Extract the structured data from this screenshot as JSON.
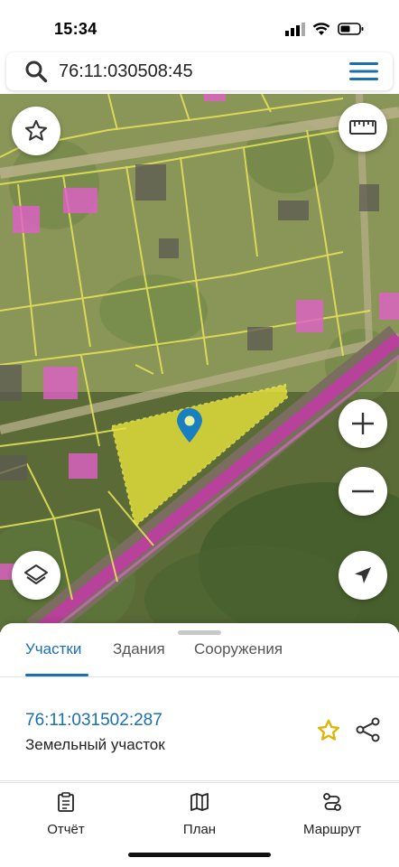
{
  "status_bar": {
    "time": "15:34",
    "battery_icon": "battery-icon",
    "wifi_icon": "wifi-icon",
    "signal_icon": "signal-icon"
  },
  "search": {
    "value": "76:11:030508:45",
    "search_icon": "search-icon",
    "menu_icon": "hamburger-menu-icon"
  },
  "map": {
    "controls": [
      "favorite-star-icon",
      "ruler-icon",
      "zoom-in-icon",
      "zoom-out-icon",
      "layers-icon",
      "locate-arrow-icon"
    ],
    "colors": {
      "parcel_outline": "#e4e05a",
      "selected_parcel": "#e8e23a",
      "building": "#e060c8",
      "road": "#c23aa6",
      "pin": "#1a7fc0"
    }
  },
  "sheet": {
    "tabs": [
      {
        "label": "Участки",
        "active": true
      },
      {
        "label": "Здания",
        "active": false
      },
      {
        "label": "Сооружения",
        "active": false
      }
    ],
    "result": {
      "cadastral_number": "76:11:031502:287",
      "type": "Земельный участок",
      "favorite_icon": "star-outline-icon",
      "share_icon": "share-icon"
    }
  },
  "bottom_nav": [
    {
      "label": "Отчёт",
      "icon": "report-icon"
    },
    {
      "label": "План",
      "icon": "map-plan-icon"
    },
    {
      "label": "Маршрут",
      "icon": "route-icon"
    }
  ],
  "colors": {
    "accent": "#1a6fb0",
    "star": "#e0b400"
  }
}
